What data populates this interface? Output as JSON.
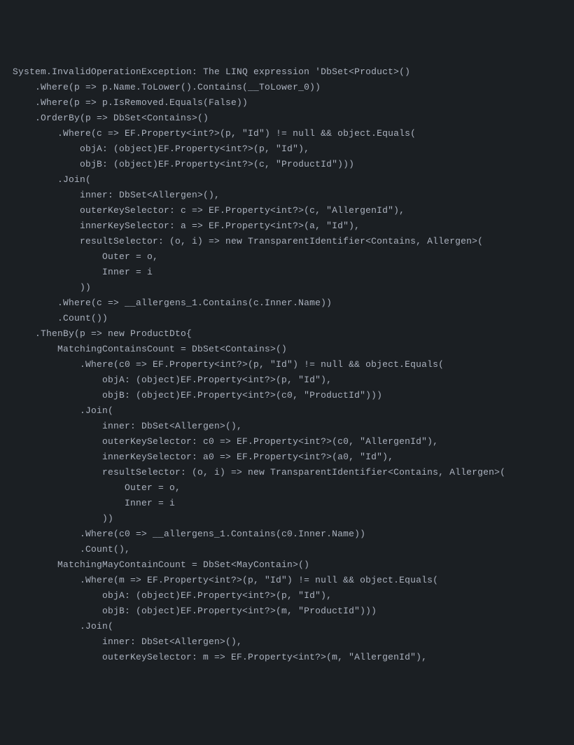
{
  "code": {
    "lines": [
      "System.InvalidOperationException: The LINQ expression 'DbSet<Product>()",
      "    .Where(p => p.Name.ToLower().Contains(__ToLower_0))",
      "    .Where(p => p.IsRemoved.Equals(False))",
      "    .OrderBy(p => DbSet<Contains>()",
      "        .Where(c => EF.Property<int?>(p, \"Id\") != null && object.Equals(",
      "            objA: (object)EF.Property<int?>(p, \"Id\"),",
      "            objB: (object)EF.Property<int?>(c, \"ProductId\")))",
      "        .Join(",
      "            inner: DbSet<Allergen>(),",
      "            outerKeySelector: c => EF.Property<int?>(c, \"AllergenId\"),",
      "            innerKeySelector: a => EF.Property<int?>(a, \"Id\"),",
      "            resultSelector: (o, i) => new TransparentIdentifier<Contains, Allergen>(",
      "                Outer = o,",
      "                Inner = i",
      "            ))",
      "        .Where(c => __allergens_1.Contains(c.Inner.Name))",
      "        .Count())",
      "    .ThenBy(p => new ProductDto{",
      "        MatchingContainsCount = DbSet<Contains>()",
      "            .Where(c0 => EF.Property<int?>(p, \"Id\") != null && object.Equals(",
      "                objA: (object)EF.Property<int?>(p, \"Id\"),",
      "                objB: (object)EF.Property<int?>(c0, \"ProductId\")))",
      "            .Join(",
      "                inner: DbSet<Allergen>(),",
      "                outerKeySelector: c0 => EF.Property<int?>(c0, \"AllergenId\"),",
      "                innerKeySelector: a0 => EF.Property<int?>(a0, \"Id\"),",
      "                resultSelector: (o, i) => new TransparentIdentifier<Contains, Allergen>(",
      "                    Outer = o,",
      "                    Inner = i",
      "                ))",
      "            .Where(c0 => __allergens_1.Contains(c0.Inner.Name))",
      "            .Count(),",
      "        MatchingMayContainCount = DbSet<MayContain>()",
      "            .Where(m => EF.Property<int?>(p, \"Id\") != null && object.Equals(",
      "                objA: (object)EF.Property<int?>(p, \"Id\"),",
      "                objB: (object)EF.Property<int?>(m, \"ProductId\")))",
      "            .Join(",
      "                inner: DbSet<Allergen>(),",
      "                outerKeySelector: m => EF.Property<int?>(m, \"AllergenId\"),"
    ]
  }
}
